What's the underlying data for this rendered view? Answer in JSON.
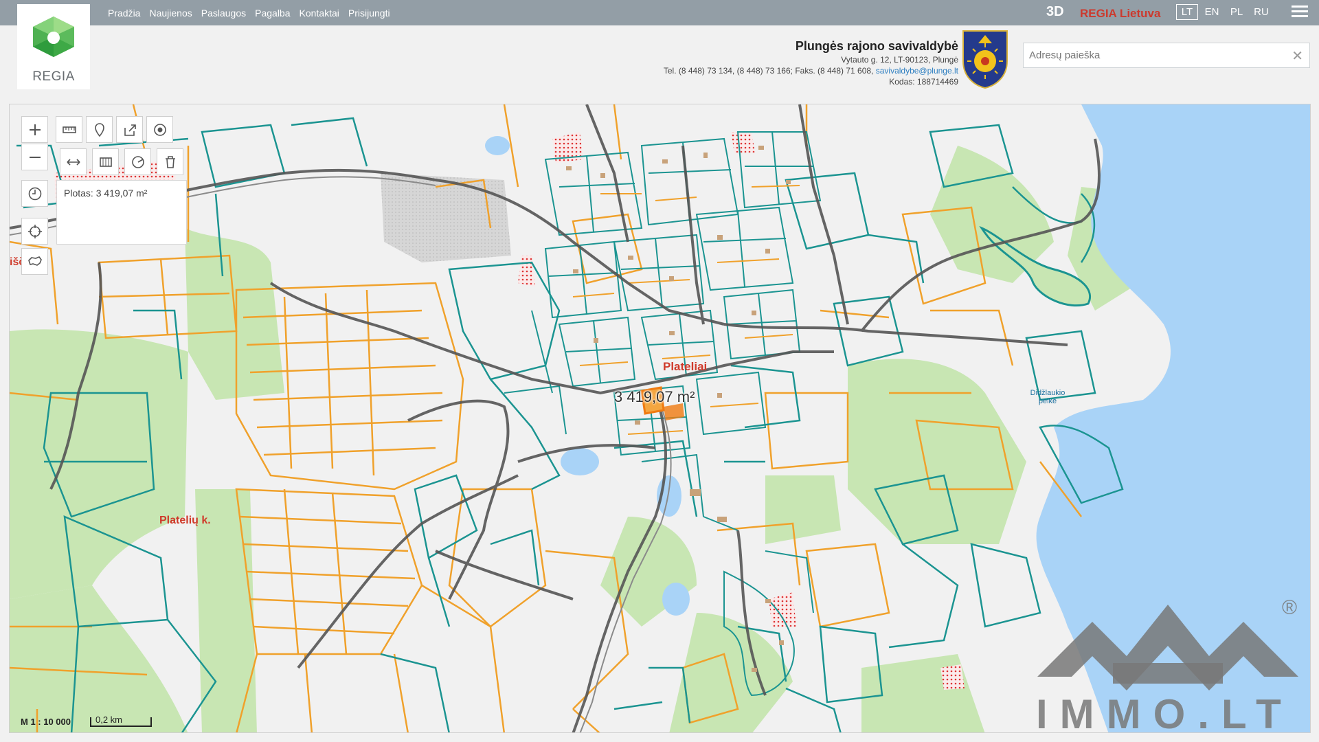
{
  "nav": {
    "items": [
      "Pradžia",
      "Naujienos",
      "Paslaugos",
      "Pagalba",
      "Kontaktai",
      "Prisijungti"
    ]
  },
  "header": {
    "btn_3d": "3D",
    "brand": "REGIA Lietuva",
    "languages": [
      "LT",
      "EN",
      "PL",
      "RU"
    ],
    "active_language": "LT",
    "logo_text": "REGIA"
  },
  "municipality": {
    "name": "Plungės rajono savivaldybė",
    "address": "Vytauto g. 12, LT-90123, Plungė",
    "phones": "Tel. (8 448) 73 134, (8 448) 73 166; Faks. (8 448) 71 608,",
    "email": "savivaldybe@plunge.lt",
    "code": "Kodas: 188714469"
  },
  "search": {
    "placeholder": "Adresų paieška",
    "value": ""
  },
  "toolbar": {
    "area_readout": "Plotas: 3 419,07 m²"
  },
  "map": {
    "measure_label": "3 419,07 m²",
    "places": [
      {
        "id": "platelis",
        "text": "Plateliai"
      },
      {
        "id": "plateliu_k",
        "text": "Platelių k."
      },
      {
        "id": "isc",
        "text": "išč. k."
      },
      {
        "id": "swamp",
        "text": "Didžlaukio pelkė"
      }
    ],
    "scale_ratio": "M 1 : 10 000",
    "scale_bar": "0,2 km",
    "colors": {
      "parcel_orange": "#f0a12b",
      "parcel_teal": "#1b9491",
      "forest": "#c8e6b3",
      "water": "#a9d3f7",
      "road": "#555555"
    }
  },
  "watermark": {
    "text": "IMMO.LT",
    "reg": "®"
  }
}
